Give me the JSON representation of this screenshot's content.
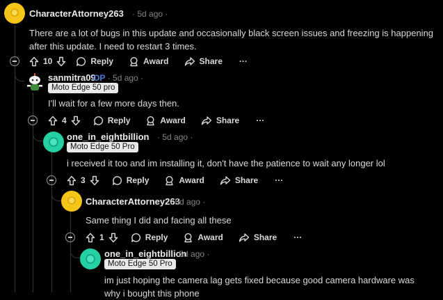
{
  "ui": {
    "dot": "·",
    "more": "···",
    "reply": "Reply",
    "award": "Award",
    "share": "Share"
  },
  "comments": [
    {
      "author": "CharacterAttorney263",
      "time": "5d ago",
      "avatar": "yellow-snoo",
      "body": "There are a lot of bugs in this update and occasionally black screen issues and freezing is happening after this update. I need to restart 3 times.",
      "votes": "10"
    },
    {
      "author": "sanmitra09",
      "badge": "OP",
      "time": "5d ago",
      "avatar": "custom-snoo",
      "flair": "Moto Edge 50 pro",
      "body": "I'll wait for a few more days then.",
      "votes": "4"
    },
    {
      "author": "one_in_eightbillion",
      "time": "5d ago",
      "avatar": "teal-snoo",
      "flair": "Moto Edge 50 Pro",
      "body": "i received it too and im installing it, don't have the patience to wait any longer lol",
      "votes": "3"
    },
    {
      "author": "CharacterAttorney263",
      "time": "5d ago",
      "avatar": "yellow-snoo",
      "body": "Same thing I did and facing all these",
      "votes": "1"
    },
    {
      "author": "one_in_eightbillion",
      "time": "5d ago",
      "avatar": "teal-snoo",
      "flair": "Moto Edge 50 Pro",
      "body": "im just hoping the camera lag gets fixed because good camera hardware was why i bought this phone"
    }
  ],
  "colors": {
    "background": "#000000",
    "text": "#d7dadc",
    "meta": "#818384",
    "op_badge": "#4f7ad6",
    "thread_line": "#343536",
    "flair_bg": "#e9e9e9"
  }
}
